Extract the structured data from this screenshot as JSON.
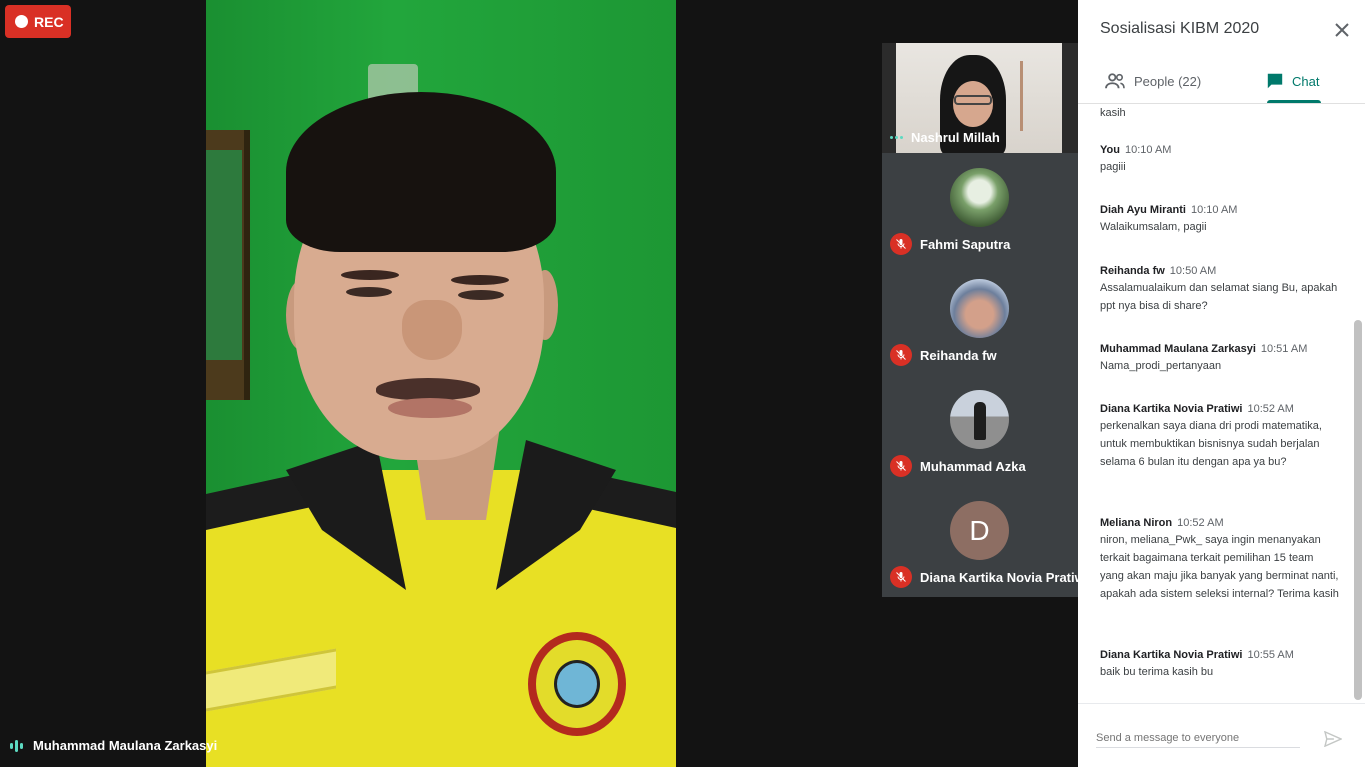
{
  "recording": {
    "label": "REC"
  },
  "main_speaker": {
    "name": "Muhammad Maulana Zarkasyi"
  },
  "participants_tiles": [
    {
      "name": "Nashrul Millah",
      "muted": false
    },
    {
      "name": "Fahmi Saputra",
      "muted": true
    },
    {
      "name": "Reihanda fw",
      "muted": true
    },
    {
      "name": "Muhammad Azka",
      "muted": true
    },
    {
      "name": "Diana Kartika Novia Pratiwi",
      "muted": true,
      "avatar_letter": "D"
    }
  ],
  "panel": {
    "title": "Sosialisasi KIBM 2020",
    "tabs": {
      "people": "People (22)",
      "chat": "Chat"
    }
  },
  "chat": {
    "partial_text": "kasih",
    "messages": [
      {
        "sender": "You",
        "time": "10:10 AM",
        "text": "pagiii"
      },
      {
        "sender": "Diah Ayu Miranti",
        "time": "10:10 AM",
        "text": "Walaikumsalam, pagii"
      },
      {
        "sender": "Reihanda fw",
        "time": "10:50 AM",
        "text": "Assalamualaikum dan selamat siang Bu, apakah ppt nya bisa di share?"
      },
      {
        "sender": "Muhammad Maulana Zarkasyi",
        "time": "10:51 AM",
        "text": "Nama_prodi_pertanyaan"
      },
      {
        "sender": "Diana Kartika Novia Pratiwi",
        "time": "10:52 AM",
        "text": "perkenalkan saya diana dri prodi matematika, untuk membuktikan bisnisnya sudah berjalan selama 6 bulan itu dengan apa ya bu?"
      },
      {
        "sender": "Meliana Niron",
        "time": "10:52 AM",
        "text": "niron, meliana_Pwk_ saya ingin menanyakan terkait bagaimana terkait pemilihan 15 team yang akan maju jika banyak yang berminat nanti, apakah ada sistem seleksi internal? Terima kasih"
      },
      {
        "sender": "Diana Kartika Novia Pratiwi",
        "time": "10:55 AM",
        "text": "baik bu terima kasih bu"
      }
    ],
    "input_placeholder": "Send a message to everyone"
  },
  "colors": {
    "accent": "#00796b",
    "rec": "#d93025",
    "mute": "#d93025"
  }
}
